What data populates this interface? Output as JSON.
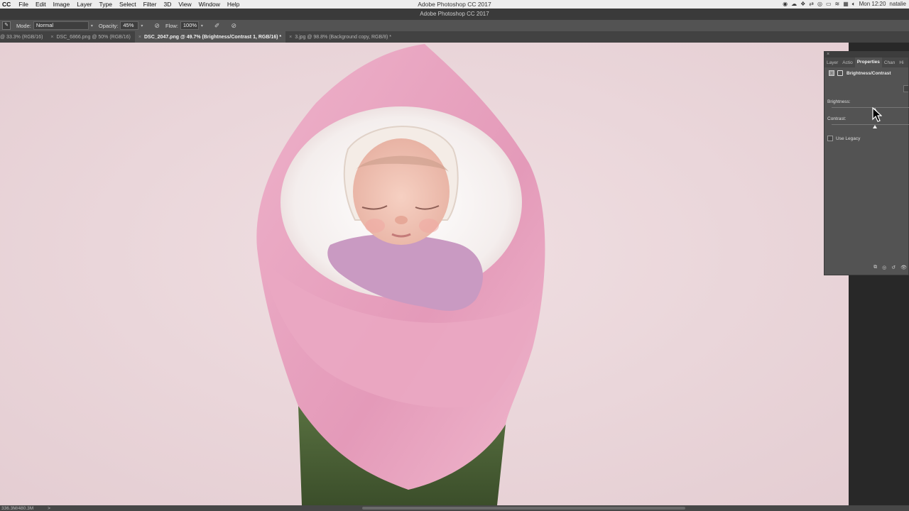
{
  "menubar": {
    "app": "CC",
    "items": [
      "File",
      "Edit",
      "Image",
      "Layer",
      "Type",
      "Select",
      "Filter",
      "3D",
      "View",
      "Window",
      "Help"
    ],
    "window_title": "Adobe Photoshop CC 2017",
    "clock": "Mon 12:20",
    "user": "natalie"
  },
  "options": {
    "mode_label": "Mode:",
    "mode_value": "Normal",
    "opacity_label": "Opacity:",
    "opacity_value": "45%",
    "flow_label": "Flow:",
    "flow_value": "100%"
  },
  "tabs": [
    {
      "label": "@ 33.3% (RGB/16)",
      "active": false
    },
    {
      "label": "DSC_6866.png @ 50% (RGB/16)",
      "active": false
    },
    {
      "label": "DSC_2047.png @ 49.7% (Brightness/Contrast 1, RGB/16) *",
      "active": true
    },
    {
      "label": "3.jpg @ 98.8% (Background copy, RGB/8) *",
      "active": false
    }
  ],
  "panel": {
    "tabs": [
      "Layer",
      "Actio",
      "Properties",
      "Chan",
      "Hi"
    ],
    "active_tab": "Properties",
    "adjustment_title": "Brightness/Contrast",
    "brightness_label": "Brightness:",
    "contrast_label": "Contrast:",
    "use_legacy_label": "Use Legacy",
    "use_legacy_checked": false
  },
  "status": {
    "doc_size": "336.3M/480.3M",
    "arrow": ">"
  },
  "colors": {
    "background_pink": "#ead6da",
    "wrap_pink": "#e7a3bf",
    "skin": "#f0c3b5",
    "leaves": "#4c6135"
  }
}
